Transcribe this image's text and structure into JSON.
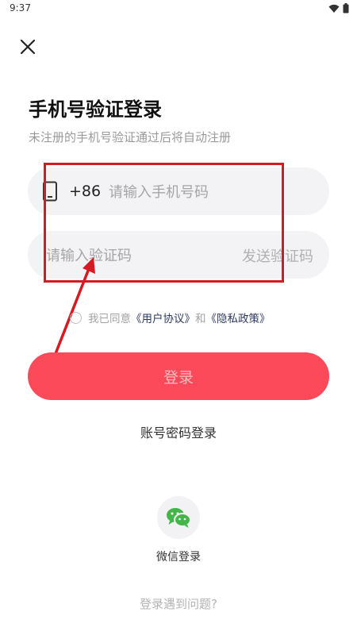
{
  "status_bar": {
    "time": "9:37",
    "icons": [
      "wifi-icon",
      "battery-icon"
    ]
  },
  "header": {
    "close_icon": "close-icon"
  },
  "login": {
    "title": "手机号验证登录",
    "subtitle": "未注册的手机号验证通过后将自动注册",
    "phone": {
      "icon": "phone-icon",
      "country_code": "+86",
      "placeholder": "请输入手机号码",
      "value": ""
    },
    "code": {
      "placeholder": "请输入验证码",
      "value": "",
      "send_label": "发送验证码"
    },
    "agreement": {
      "prefix": "我已同意",
      "user_agreement": "《用户协议》",
      "and": "和",
      "privacy_policy": "《隐私政策》",
      "checked": false
    },
    "submit_label": "登录",
    "password_login": "账号密码登录",
    "wechat_label": "微信登录",
    "help": "登录遇到问题?"
  },
  "colors": {
    "primary": "#fd4a5a",
    "annotation": "#d71921",
    "wechat": "#44b549"
  }
}
